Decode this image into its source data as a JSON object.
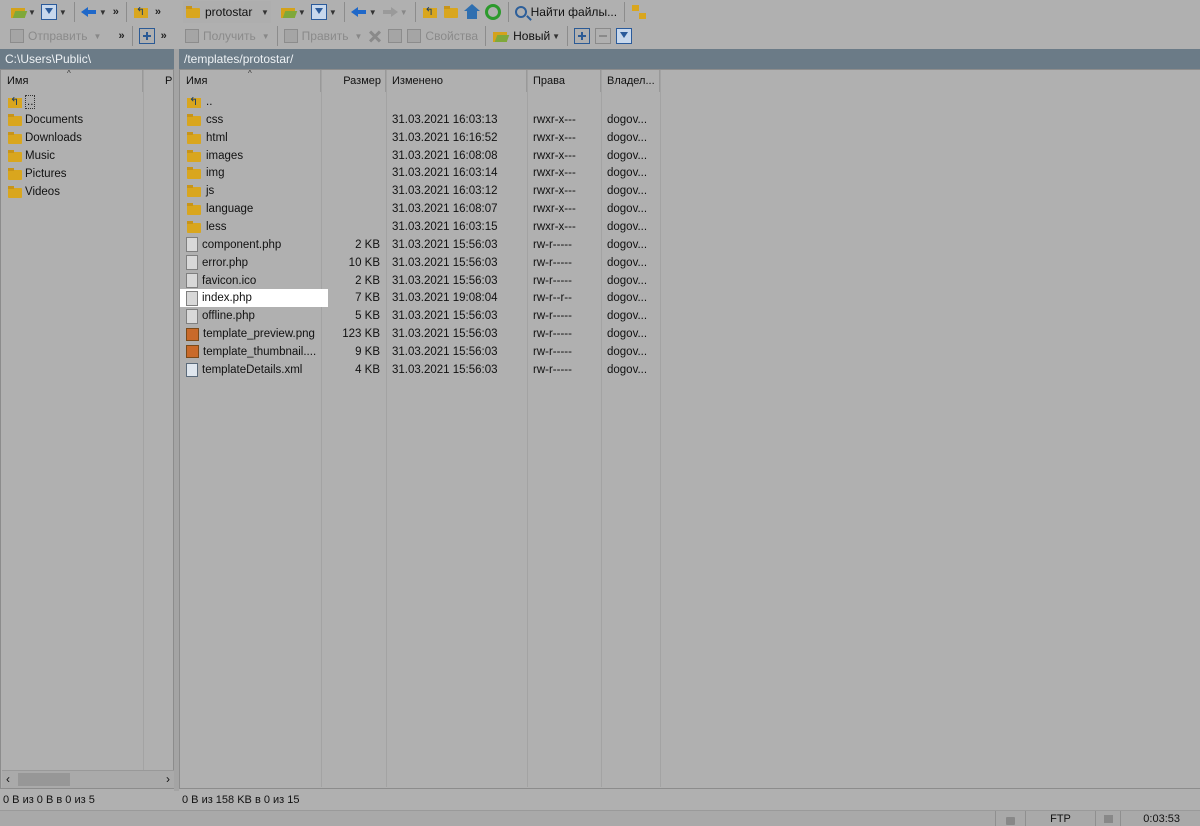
{
  "toolbar_left_row1": {
    "more": "»"
  },
  "toolbar_left_row2": {
    "send_label": "Отправить",
    "more": "»"
  },
  "toolbar_right_row1": {
    "site_label": "protostar",
    "find_label": "Найти файлы..."
  },
  "toolbar_right_row2": {
    "get_label": "Получить",
    "edit_label": "Править",
    "props_label": "Свойства",
    "new_label": "Новый"
  },
  "left_panel": {
    "path": "C:\\Users\\Public\\",
    "columns": [
      "Имя",
      "Р"
    ],
    "items": [
      {
        "name": "..",
        "type": "up"
      },
      {
        "name": "Documents",
        "type": "folder"
      },
      {
        "name": "Downloads",
        "type": "folder"
      },
      {
        "name": "Music",
        "type": "folder"
      },
      {
        "name": "Pictures",
        "type": "folder"
      },
      {
        "name": "Videos",
        "type": "folder"
      }
    ],
    "status": "0 В из 0 В в 0 из 5"
  },
  "right_panel": {
    "path": "/templates/protostar/",
    "columns": {
      "name": "Имя",
      "size": "Размер",
      "modified": "Изменено",
      "rights": "Права",
      "owner": "Владел..."
    },
    "items": [
      {
        "name": "..",
        "size": "",
        "modified": "",
        "rights": "",
        "owner": "",
        "type": "up"
      },
      {
        "name": "css",
        "size": "",
        "modified": "31.03.2021 16:03:13",
        "rights": "rwxr-x---",
        "owner": "dogov...",
        "type": "folder"
      },
      {
        "name": "html",
        "size": "",
        "modified": "31.03.2021 16:16:52",
        "rights": "rwxr-x---",
        "owner": "dogov...",
        "type": "folder"
      },
      {
        "name": "images",
        "size": "",
        "modified": "31.03.2021 16:08:08",
        "rights": "rwxr-x---",
        "owner": "dogov...",
        "type": "folder"
      },
      {
        "name": "img",
        "size": "",
        "modified": "31.03.2021 16:03:14",
        "rights": "rwxr-x---",
        "owner": "dogov...",
        "type": "folder"
      },
      {
        "name": "js",
        "size": "",
        "modified": "31.03.2021 16:03:12",
        "rights": "rwxr-x---",
        "owner": "dogov...",
        "type": "folder"
      },
      {
        "name": "language",
        "size": "",
        "modified": "31.03.2021 16:08:07",
        "rights": "rwxr-x---",
        "owner": "dogov...",
        "type": "folder"
      },
      {
        "name": "less",
        "size": "",
        "modified": "31.03.2021 16:03:15",
        "rights": "rwxr-x---",
        "owner": "dogov...",
        "type": "folder"
      },
      {
        "name": "component.php",
        "size": "2 KB",
        "modified": "31.03.2021 15:56:03",
        "rights": "rw-r-----",
        "owner": "dogov...",
        "type": "doc"
      },
      {
        "name": "error.php",
        "size": "10 KB",
        "modified": "31.03.2021 15:56:03",
        "rights": "rw-r-----",
        "owner": "dogov...",
        "type": "doc"
      },
      {
        "name": "favicon.ico",
        "size": "2 KB",
        "modified": "31.03.2021 15:56:03",
        "rights": "rw-r-----",
        "owner": "dogov...",
        "type": "doc"
      },
      {
        "name": "index.php",
        "size": "7 KB",
        "modified": "31.03.2021 19:08:04",
        "rights": "rw-r--r--",
        "owner": "dogov...",
        "type": "doc",
        "selected": true
      },
      {
        "name": "offline.php",
        "size": "5 KB",
        "modified": "31.03.2021 15:56:03",
        "rights": "rw-r-----",
        "owner": "dogov...",
        "type": "doc"
      },
      {
        "name": "template_preview.png",
        "size": "123 KB",
        "modified": "31.03.2021 15:56:03",
        "rights": "rw-r-----",
        "owner": "dogov...",
        "type": "img-file"
      },
      {
        "name": "template_thumbnail....",
        "size": "9 KB",
        "modified": "31.03.2021 15:56:03",
        "rights": "rw-r-----",
        "owner": "dogov...",
        "type": "img-file"
      },
      {
        "name": "templateDetails.xml",
        "size": "4 KB",
        "modified": "31.03.2021 15:56:03",
        "rights": "rw-r-----",
        "owner": "dogov...",
        "type": "xml-file"
      }
    ],
    "status": "0 В из 158 KB в 0 из 15"
  },
  "bottom_bar": {
    "protocol": "FTP",
    "time": "0:03:53"
  }
}
